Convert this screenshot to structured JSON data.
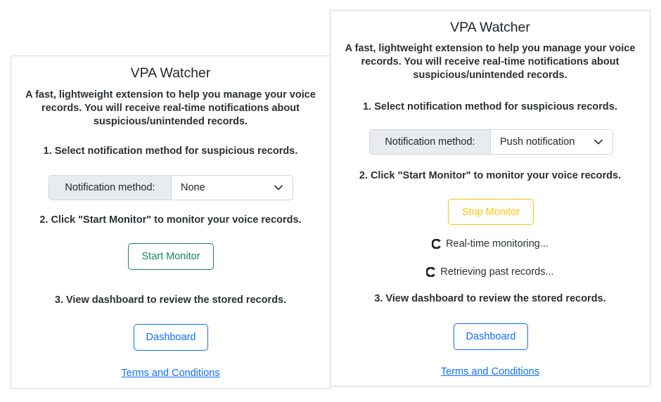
{
  "left_panel": {
    "title": "VPA Watcher",
    "description": "A fast, lightweight extension to help you manage your voice records. You will receive real-time notifications about suspicious/unintended records.",
    "step1": "1. Select notification method for suspicious records.",
    "method_label": "Notification method:",
    "method_value": "None",
    "step2": "2. Click \"Start Monitor\" to monitor your voice records.",
    "monitor_button": "Start Monitor",
    "step3": "3. View dashboard to review the stored records.",
    "dashboard_button": "Dashboard",
    "terms_link": "Terms and Conditions"
  },
  "right_panel": {
    "title": "VPA Watcher",
    "description": "A fast, lightweight extension to help you manage your voice records. You will receive real-time notifications about suspicious/unintended records.",
    "step1": "1. Select notification method for suspicious records.",
    "method_label": "Notification method:",
    "method_value": "Push notification",
    "step2": "2. Click \"Start Monitor\" to monitor your voice records.",
    "monitor_button": "Stop Monitor",
    "status_realtime": "Real-time monitoring...",
    "status_past": "Retrieving past records...",
    "step3": "3. View dashboard to review the stored records.",
    "dashboard_button": "Dashboard",
    "terms_link": "Terms and Conditions"
  },
  "icons": {
    "select_arrow": "chevron-down-icon",
    "loading": "spinner-icon"
  },
  "colors": {
    "success": "#198754",
    "warning": "#ffc107",
    "primary": "#0d6efd",
    "label_bg": "#e9ecef"
  }
}
